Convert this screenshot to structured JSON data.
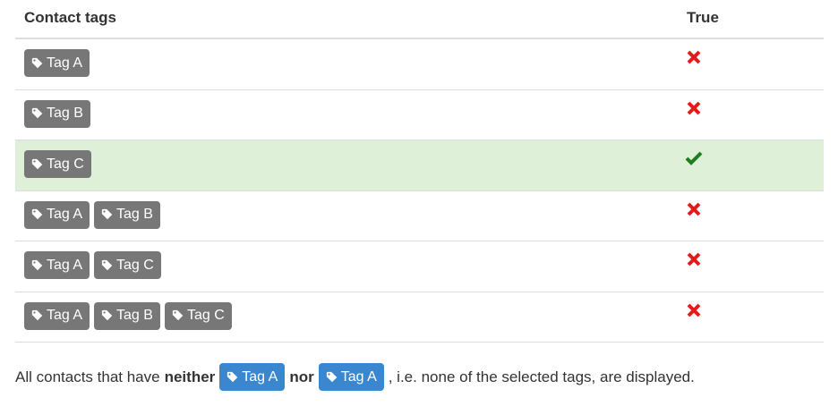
{
  "table": {
    "headers": {
      "tags": "Contact tags",
      "result": "True"
    },
    "rows": [
      {
        "tags": [
          "Tag A"
        ],
        "result": "false",
        "highlight": false
      },
      {
        "tags": [
          "Tag B"
        ],
        "result": "false",
        "highlight": false
      },
      {
        "tags": [
          "Tag C"
        ],
        "result": "true",
        "highlight": true
      },
      {
        "tags": [
          "Tag A",
          "Tag B"
        ],
        "result": "false",
        "highlight": false
      },
      {
        "tags": [
          "Tag A",
          "Tag C"
        ],
        "result": "false",
        "highlight": false
      },
      {
        "tags": [
          "Tag A",
          "Tag B",
          "Tag C"
        ],
        "result": "false",
        "highlight": false
      }
    ]
  },
  "note": {
    "prefix": "All contacts that have",
    "neither": "neither",
    "tag1": "Tag A",
    "nor": "nor",
    "tag2": "Tag A",
    "suffix": ", i.e. none of the selected tags, are displayed."
  },
  "icons": {
    "tag": "tag-icon",
    "cross": "cross-icon",
    "check": "check-icon"
  },
  "colors": {
    "tag_gray": "#777777",
    "tag_blue": "#3a87cf",
    "cross": "#e31b1b",
    "check": "#1e7d1e",
    "highlight": "#dff0d8"
  }
}
